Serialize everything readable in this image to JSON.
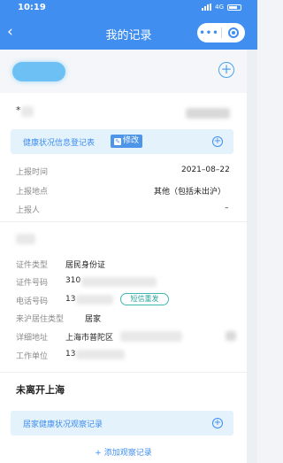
{
  "status_bar": {
    "time": "10:19",
    "network": "4G"
  },
  "nav": {
    "back_icon": "chevron-left-icon",
    "title": "我的记录",
    "more": "•••",
    "close_icon": "target-icon"
  },
  "topbar": {
    "add_icon": "plus-circle-icon"
  },
  "person": {
    "name_prefix": "*"
  },
  "health_form": {
    "title": "健康状况信息登记表",
    "edit_label": "修改",
    "expand_icon": "plus-circle-icon"
  },
  "report": {
    "time_label": "上报时间",
    "time_value": "2021–08–22",
    "place_label": "上报地点",
    "place_value": "其他（包括未出沪）",
    "reporter_label": "上报人",
    "reporter_value": "–"
  },
  "identity": {
    "id_type_label": "证件类型",
    "id_type_value": "居民身份证",
    "id_no_label": "证件号码",
    "id_no_value": "310",
    "phone_label": "电话号码",
    "phone_value": "13",
    "resend_label": "短信重发",
    "residence_type_label": "来沪居住类型",
    "residence_type_value": "居家",
    "address_label": "详细地址",
    "address_value": "上海市普陀区",
    "work_label": "工作单位",
    "work_value": "13"
  },
  "status_section": {
    "title": "未离开上海"
  },
  "observation": {
    "title": "居家健康状况观察记录",
    "expand_icon": "plus-circle-icon",
    "add_label": "+ 添加观察记录"
  },
  "colors": {
    "primary": "#3f8ef0",
    "banner": "#e4f2fb",
    "resend": "#2aa49c"
  }
}
